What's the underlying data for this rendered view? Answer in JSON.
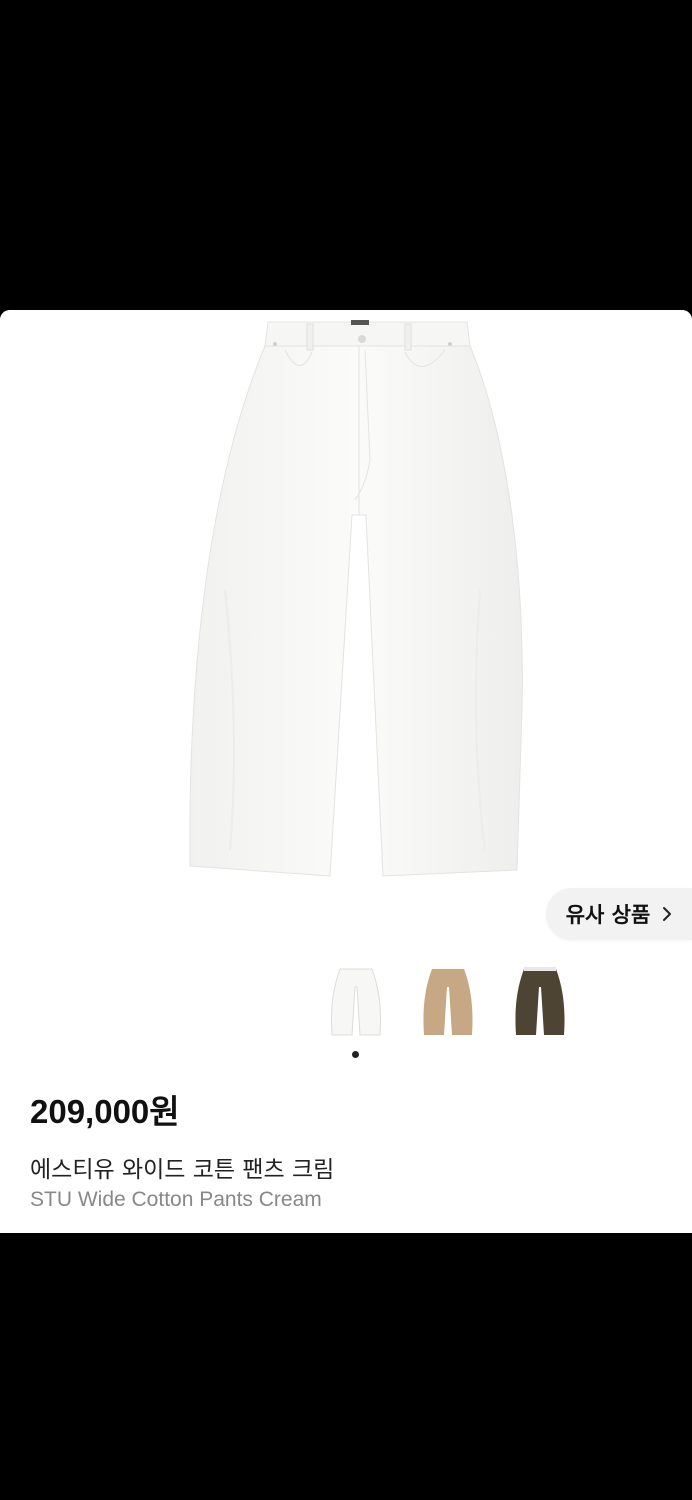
{
  "product": {
    "price": "209,000원",
    "name_ko": "에스티유 와이드 코튼 팬츠 크림",
    "name_en": "STU Wide Cotton Pants Cream",
    "main_image_icon": "wide-pants-cream-photo"
  },
  "similar": {
    "label": "유사 상품",
    "icon": "chevron-right-icon"
  },
  "variants": [
    {
      "icon": "pants-cream-thumbnail",
      "color": "#f4f4f2"
    },
    {
      "icon": "pants-beige-thumbnail",
      "color": "#c6a984"
    },
    {
      "icon": "pants-olive-thumbnail",
      "color": "#4e4433"
    }
  ],
  "carousel": {
    "total": 1,
    "active": 1
  }
}
